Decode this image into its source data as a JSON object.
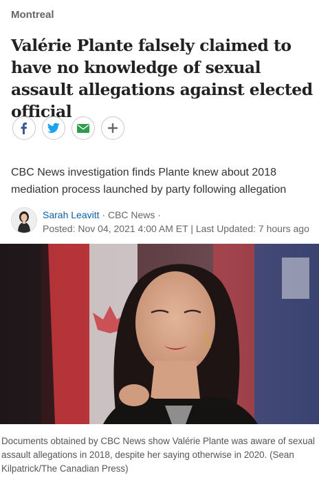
{
  "section": "Montreal",
  "headline": "Valérie Plante falsely claimed to have no knowledge of sexual assault allegations against elected official",
  "share": {
    "facebook_icon": "facebook-icon",
    "twitter_icon": "twitter-icon",
    "email_icon": "email-icon",
    "more_icon": "plus-icon"
  },
  "dek": "CBC News investigation finds Plante knew about 2018 mediation process launched by party following allegation",
  "byline": {
    "author": "Sarah Leavitt",
    "sep1": " · ",
    "outlet": "CBC News",
    "sep2": " ·",
    "posted": "Posted: Nov 04, 2021 4:00 AM ET | Last Updated: 7 hours ago"
  },
  "caption": "Documents obtained by CBC News show Valérie Plante was aware of sexual assault allegations in 2018, despite her saying otherwise in 2020. (Sean Kilpatrick/The Canadian Press)",
  "colors": {
    "facebook": "#3b5998",
    "twitter": "#1da1f2",
    "email": "#2e9c4e",
    "link": "#0b5fa5"
  }
}
